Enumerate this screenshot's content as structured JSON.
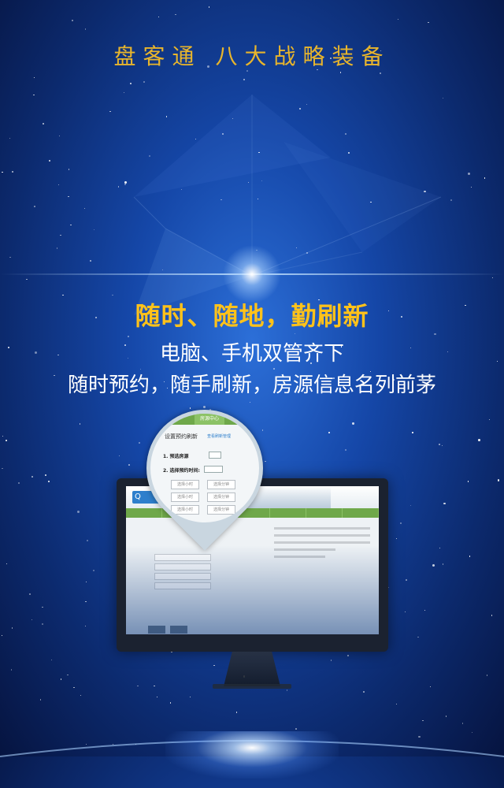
{
  "header": {
    "title": "盘客通   八大战略装备"
  },
  "feature": {
    "headline": "随时、随地，勤刷新",
    "line1": "电脑、手机双管齐下",
    "line2": "随时预约，随手刷新，房源信息名列前茅"
  },
  "magnifier": {
    "tab": "房源中心",
    "heading": "设置预约刷新",
    "heading_link": "查看刷新管理",
    "step1": "1. 预选房源",
    "step2": "2. 选择预约时间:",
    "slot_start": "选择小时",
    "slot_end": "选择分钟"
  },
  "colors": {
    "accent_gold": "#ffc21a",
    "title_gold": "#e8b52c",
    "bar_green": "#6fa84a"
  },
  "icons": [
    "monitor-icon",
    "magnifier-icon",
    "flare-icon"
  ]
}
